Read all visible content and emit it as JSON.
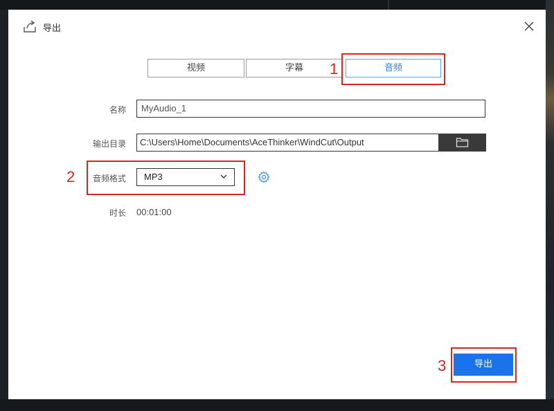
{
  "dialog": {
    "title": "导出",
    "tabs": [
      {
        "label": "视频",
        "active": false
      },
      {
        "label": "字幕",
        "active": false
      },
      {
        "label": "音频",
        "active": true
      }
    ],
    "fields": {
      "name_label": "名称",
      "name_value": "MyAudio_1",
      "output_dir_label": "输出目录",
      "output_dir_value": "C:\\Users\\Home\\Documents\\AceThinker\\WindCut\\Output",
      "format_label": "音频格式",
      "format_value": "MP3",
      "duration_label": "时长",
      "duration_value": "00:01:00"
    },
    "export_button_label": "导出"
  },
  "annotations": {
    "step1": "1",
    "step2": "2",
    "step3": "3"
  },
  "colors": {
    "accent": "#1a73e8",
    "active_tab": "#2d86d6",
    "annotation": "#d42424"
  },
  "icons": {
    "title": "export-icon",
    "close": "close-icon",
    "folder": "folder-icon",
    "dropdown": "chevron-down-icon",
    "settings": "gear-icon"
  }
}
